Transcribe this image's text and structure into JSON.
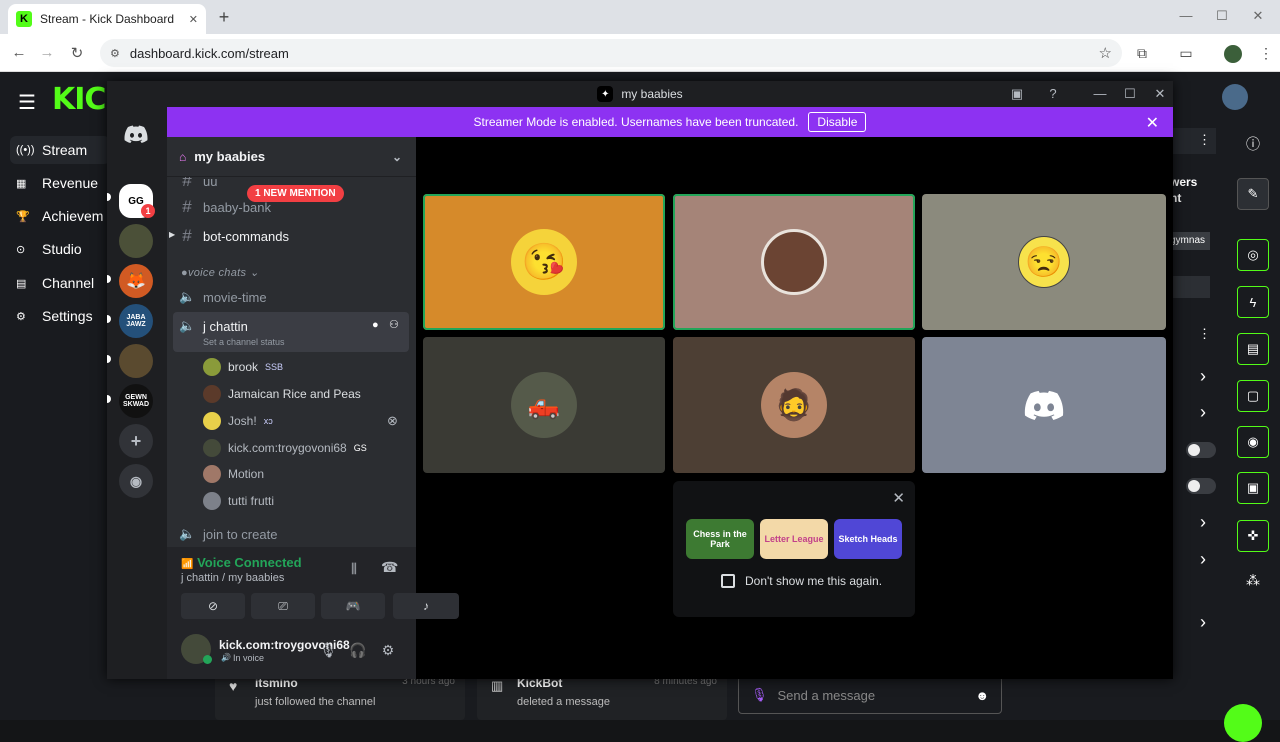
{
  "browser": {
    "tab_title": "Stream - Kick Dashboard",
    "tab_close": "✕",
    "new_tab": "+",
    "url": "dashboard.kick.com/stream"
  },
  "kick": {
    "logo": "KICK",
    "nav": [
      {
        "label": "Stream",
        "icon": "broadcast-icon",
        "glyph": "((•))"
      },
      {
        "label": "Revenue",
        "icon": "revenue-icon",
        "glyph": "▦"
      },
      {
        "label": "Achievem",
        "icon": "trophy-icon",
        "glyph": "🏆"
      },
      {
        "label": "Studio",
        "icon": "studio-icon",
        "glyph": "⊙"
      },
      {
        "label": "Channel",
        "icon": "channel-icon",
        "glyph": "▤"
      },
      {
        "label": "Settings",
        "icon": "settings-icon",
        "glyph": "⚙"
      }
    ],
    "partial_panel": {
      "line1": "wers",
      "line2": "ht",
      "chip": "gymnas"
    },
    "feed": [
      {
        "name": "itsmino",
        "time": "3 hours ago",
        "desc": "just followed the channel"
      },
      {
        "name": "KickBot",
        "time": "8 minutes ago",
        "desc": "deleted a message"
      }
    ],
    "message_placeholder": "Send a message",
    "accent": "#53fc18"
  },
  "discord": {
    "window_title": "my baabies",
    "banner": {
      "text": "Streamer Mode is enabled. Usernames have been truncated.",
      "button": "Disable"
    },
    "server_name": "my baabies",
    "new_mention": "1 NEW MENTION",
    "channels": [
      {
        "name": "uu",
        "type": "text"
      },
      {
        "name": "baaby-bank",
        "type": "text"
      },
      {
        "name": "bot-commands",
        "type": "text"
      }
    ],
    "voice_category": "voice chats",
    "voice_channels": [
      {
        "name": "movie-time"
      },
      {
        "name": "j chattin",
        "status": "Set a channel status"
      }
    ],
    "voice_users": [
      {
        "name": "brook",
        "tag": "SSB"
      },
      {
        "name": "Jamaican Rice and Peas",
        "tag": ""
      },
      {
        "name": "Josh!",
        "tag": "xɔ"
      },
      {
        "name": "kick.com:troygovoni68",
        "tag": "GS"
      },
      {
        "name": "Motion",
        "tag": ""
      },
      {
        "name": "tutti frutti",
        "tag": ""
      }
    ],
    "join_channel": "join to create",
    "voice_panel": {
      "status": "Voice Connected",
      "location": "j chattin / my baabies"
    },
    "user": {
      "name": "kick.com:troygovoni68",
      "status": "In voice"
    },
    "servers": [
      {
        "label": "GG",
        "badge": "1"
      },
      {
        "label": "",
        "badge": ""
      },
      {
        "label": "",
        "badge": ""
      },
      {
        "label": "JABA JAWZ",
        "badge": ""
      },
      {
        "label": "",
        "badge": ""
      },
      {
        "label": "GEWN SKWAD",
        "badge": ""
      }
    ],
    "activities": [
      {
        "label": "Chess in the Park"
      },
      {
        "label": "Letter League"
      },
      {
        "label": "Sketch Heads"
      }
    ],
    "dont_show": "Don't show me this again.",
    "blurple": "#5865f2",
    "banner_color": "#8d32f2",
    "speaking_color": "#23a559"
  }
}
